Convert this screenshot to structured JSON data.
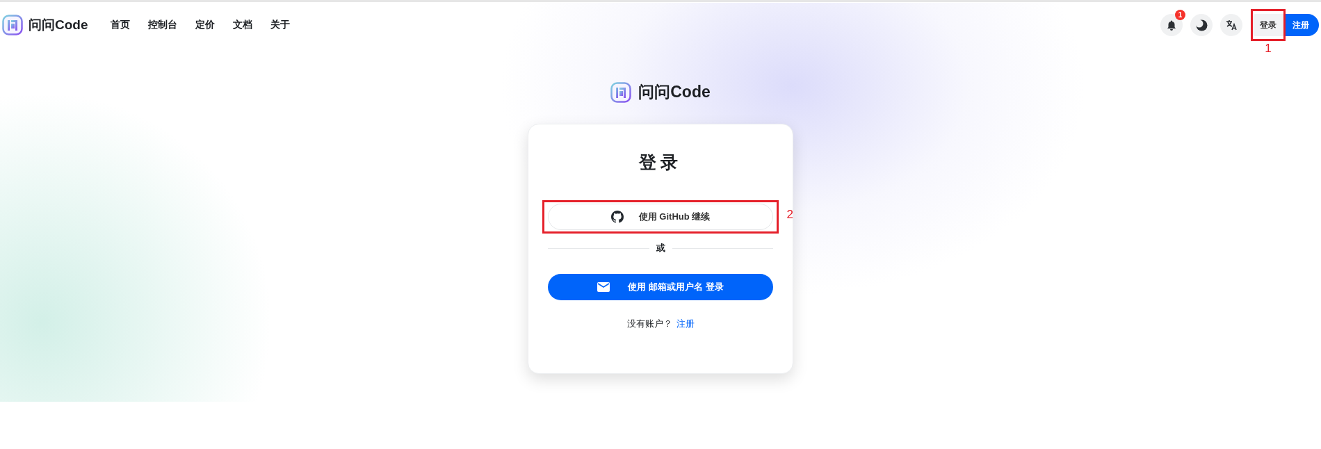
{
  "header": {
    "logo": "问问Code",
    "nav": [
      {
        "label": "首页"
      },
      {
        "label": "控制台"
      },
      {
        "label": "定价"
      },
      {
        "label": "文档"
      },
      {
        "label": "关于"
      }
    ],
    "notification_badge": "1",
    "buttons": [
      {
        "label": "登录",
        "kind": "secondary"
      },
      {
        "label": "注册",
        "kind": "primary"
      }
    ]
  },
  "brand": "问问Code",
  "card": {
    "title": "登录",
    "github_button": "使用 GitHub 继续",
    "divider": "或",
    "email_button": "使用 邮箱或用户名 登录",
    "footer_text": "没有账户？",
    "footer_link": "注册"
  },
  "annotations": [
    {
      "number": "1"
    },
    {
      "number": "2"
    }
  ]
}
